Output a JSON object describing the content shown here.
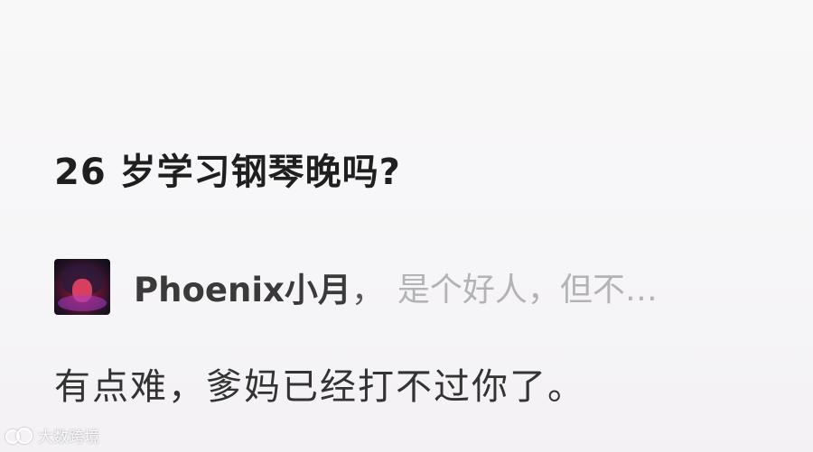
{
  "question": {
    "title": "26 岁学习钢琴晚吗?"
  },
  "answer": {
    "author": {
      "name": "Phoenix小月",
      "separator": "，",
      "bio": "是个好人，但不…"
    },
    "text": "有点难，爹妈已经打不过你了。"
  },
  "watermark": {
    "logo_icon": "brand-logo-icon",
    "text": "大数跨境"
  }
}
